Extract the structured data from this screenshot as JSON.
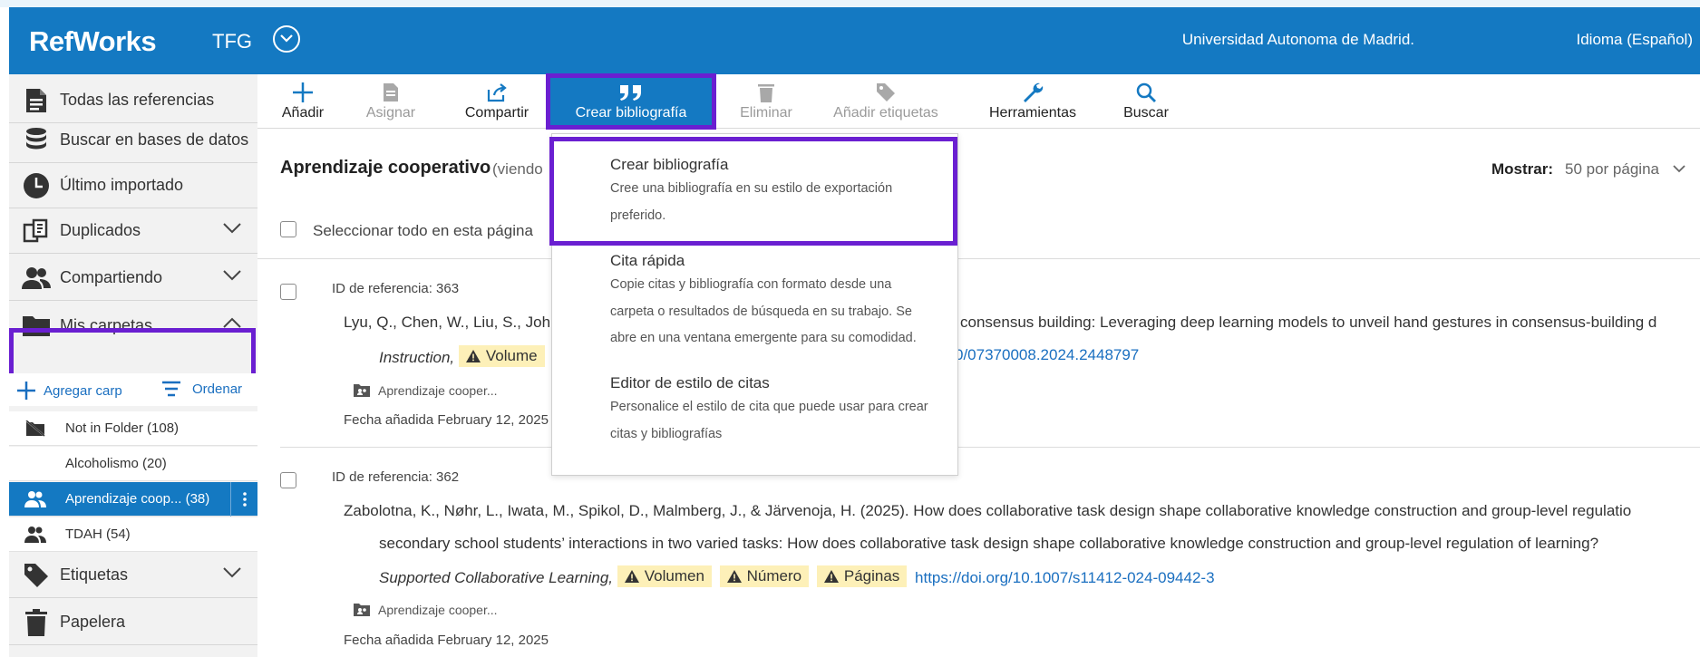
{
  "header": {
    "logo": "RefWorks",
    "project": "TFG",
    "university": "Universidad Autonoma de Madrid.",
    "language": "Idioma (Español)"
  },
  "sidebar": {
    "items": [
      {
        "label": "Todas las referencias"
      },
      {
        "label": "Buscar en bases de datos"
      },
      {
        "label": "Último importado"
      },
      {
        "label": "Duplicados"
      },
      {
        "label": "Compartiendo"
      },
      {
        "label": "Mis carpetas"
      },
      {
        "label": "Etiquetas"
      },
      {
        "label": "Papelera"
      }
    ],
    "add_folder": "Agregar carp",
    "sort": "Ordenar",
    "folders": [
      {
        "label": "Not in Folder (108)"
      },
      {
        "label": "Alcoholismo (20)"
      },
      {
        "label": "Aprendizaje coop... (38)"
      },
      {
        "label": "TDAH (54)"
      }
    ]
  },
  "toolbar": {
    "add": "Añadir",
    "assign": "Asignar",
    "share": "Compartir",
    "create_bib": "Crear bibliografía",
    "delete": "Eliminar",
    "add_tags": "Añadir etiquetas",
    "tools": "Herramientas",
    "search": "Buscar"
  },
  "main": {
    "folder_title": "Aprendizaje cooperativo",
    "viewing": "(viendo",
    "show_label": "Mostrar:",
    "per_page": "50 por página",
    "select_all": "Seleccionar todo en esta página"
  },
  "references": [
    {
      "id": "ID de referencia: 363",
      "line1_left": "Lyu, Q., Chen, W., Liu, S., John",
      "line1_right": "consensus building: Leveraging deep learning models to unveil hand gestures in consensus-building d",
      "journal": "Instruction,",
      "badge_volume": "Volume",
      "doi": "0/07370008.2024.2448797",
      "folder": "Aprendizaje cooper...",
      "date": "Fecha añadida February 12, 2025"
    },
    {
      "id": "ID de referencia: 362",
      "line1": "Zabolotna, K., Nøhr, L., Iwata, M., Spikol, D., Malmberg, J., & Järvenoja, H. (2025). How does collaborative task design shape collaborative knowledge construction and group-level regulatio",
      "line2": "secondary school students’ interactions in two varied tasks: How does collaborative task design shape collaborative knowledge construction and group-level regulation of learning? ",
      "journal": "Supported Collaborative Learning,",
      "badge_volume": "Volumen",
      "badge_number": "Número",
      "badge_pages": "Páginas",
      "doi": "https://doi.org/10.1007/s11412-024-09442-3",
      "folder": "Aprendizaje cooper...",
      "date": "Fecha añadida February 12, 2025"
    }
  ],
  "dropdown": {
    "items": [
      {
        "title": "Crear bibliografía",
        "desc1": "Cree una bibliografía en su estilo de exportación",
        "desc2": "preferido."
      },
      {
        "title": "Cita rápida",
        "desc1": "Copie citas y bibliografía con formato desde una",
        "desc2": "carpeta o resultados de búsqueda en su trabajo. Se",
        "desc3": "abre en una ventana emergente para su comodidad."
      },
      {
        "title": "Editor de estilo de citas",
        "desc1": "Personalice el estilo de cita que puede usar para crear",
        "desc2": "citas y bibliografías"
      }
    ]
  },
  "colors": {
    "brand_blue": "#1479c2",
    "highlight_purple": "#6a1fd1",
    "warning_badge": "#fdf0b8",
    "link": "#1a6fc0"
  }
}
